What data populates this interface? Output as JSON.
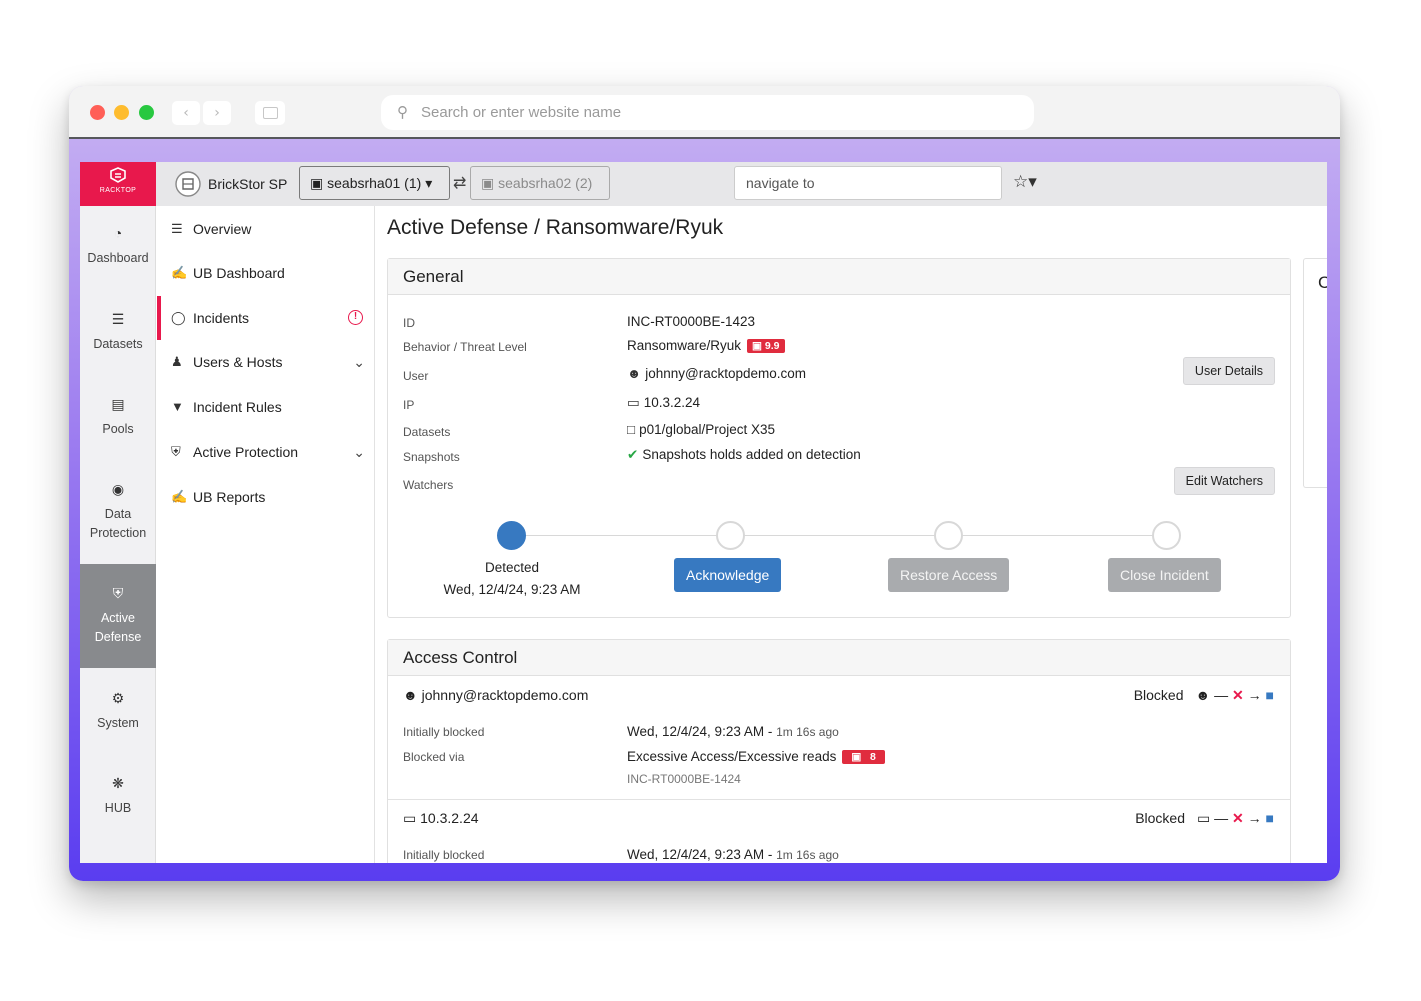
{
  "browser": {
    "search_placeholder": "Search or enter website name",
    "back_icon": "chevron-left-icon",
    "forward_icon": "chevron-right-icon"
  },
  "topbar": {
    "logo_text": "RACKTOP",
    "brand": "BrickStor SP",
    "node_active": "seabsrha01 (1)",
    "node_inactive": "seabsrha02 (2)",
    "navigate_placeholder": "navigate to"
  },
  "leftnav": {
    "items": [
      {
        "label": "Dashboard"
      },
      {
        "label": "Datasets"
      },
      {
        "label": "Pools"
      },
      {
        "label": "Data",
        "label2": "Protection"
      },
      {
        "label": "Active",
        "label2": "Defense"
      },
      {
        "label": "System"
      },
      {
        "label": "HUB"
      }
    ]
  },
  "subnav": {
    "items": [
      {
        "label": "Overview"
      },
      {
        "label": "UB Dashboard"
      },
      {
        "label": "Incidents"
      },
      {
        "label": "Users & Hosts"
      },
      {
        "label": "Incident Rules"
      },
      {
        "label": "Active Protection"
      },
      {
        "label": "UB Reports"
      }
    ]
  },
  "page": {
    "title": "Active Defense / Ransomware/Ryuk"
  },
  "general": {
    "title": "General",
    "rows": {
      "id_label": "ID",
      "id_value": "INC-RT0000BE-1423",
      "behavior_label": "Behavior / Threat Level",
      "behavior_value": "Ransomware/Ryuk",
      "threat_level": "9.9",
      "user_label": "User",
      "user_value": "johnny@racktopdemo.com",
      "ip_label": "IP",
      "ip_value": "10.3.2.24",
      "datasets_label": "Datasets",
      "datasets_value": "p01/global/Project X35",
      "snapshots_label": "Snapshots",
      "snapshots_value": "Snapshots holds added on detection",
      "watchers_label": "Watchers"
    },
    "user_details_button": "User Details",
    "edit_watchers_button": "Edit Watchers",
    "progress": {
      "detected_label": "Detected",
      "detected_time": "Wed, 12/4/24, 9:23 AM",
      "acknowledge": "Acknowledge",
      "restore": "Restore Access",
      "close": "Close Incident"
    }
  },
  "access_control": {
    "title": "Access Control",
    "entries": [
      {
        "subject": "johnny@racktopdemo.com",
        "status": "Blocked",
        "initially_label": "Initially blocked",
        "initially_value": "Wed, 12/4/24, 9:23 AM",
        "ago": "1m 16s ago",
        "via_label": "Blocked via",
        "via_value": "Excessive Access/Excessive reads",
        "via_level": "8",
        "via_ref": "INC-RT0000BE-1424"
      },
      {
        "subject": "10.3.2.24",
        "status": "Blocked",
        "initially_label": "Initially blocked",
        "initially_value": "Wed, 12/4/24, 9:23 AM",
        "ago": "1m 16s ago"
      }
    ]
  },
  "colors": {
    "brand": "#e8184c",
    "primary": "#3779c1",
    "danger": "#e02c3e"
  }
}
